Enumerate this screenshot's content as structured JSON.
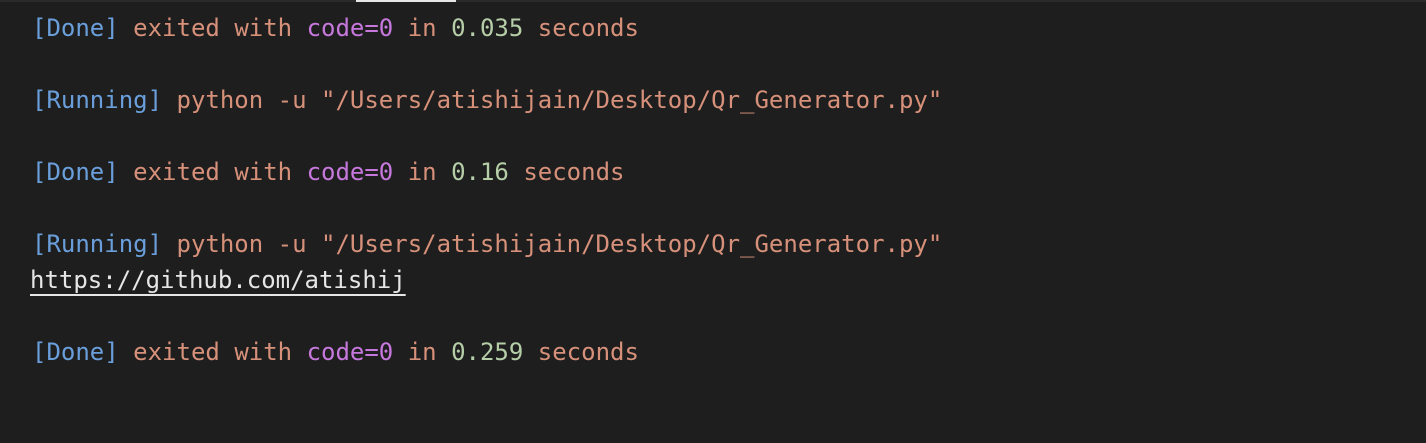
{
  "output_lines": [
    {
      "type": "done",
      "tag": "[Done]",
      "exited": "exited",
      "with": "with",
      "code": "code=0",
      "in": "in",
      "time": "0.035",
      "unit": "seconds"
    },
    {
      "type": "running",
      "tag": "[Running]",
      "command": "python -u \"/Users/atishijain/Desktop/Qr_Generator.py\""
    },
    {
      "type": "done",
      "tag": "[Done]",
      "exited": "exited",
      "with": "with",
      "code": "code=0",
      "in": "in",
      "time": "0.16",
      "unit": "seconds"
    },
    {
      "type": "running",
      "tag": "[Running]",
      "command": "python -u \"/Users/atishijain/Desktop/Qr_Generator.py\""
    },
    {
      "type": "link",
      "text": "https://github.com/atishij"
    },
    {
      "type": "done",
      "tag": "[Done]",
      "exited": "exited",
      "with": "with",
      "code": "code=0",
      "in": "in",
      "time": "0.259",
      "unit": "seconds"
    }
  ],
  "colors": {
    "background": "#1e1e1e",
    "tag": "#6a9fdc",
    "text": "#d7917a",
    "keyword": "#c678dd",
    "number": "#b5cea8",
    "link": "#e6e6e6"
  }
}
